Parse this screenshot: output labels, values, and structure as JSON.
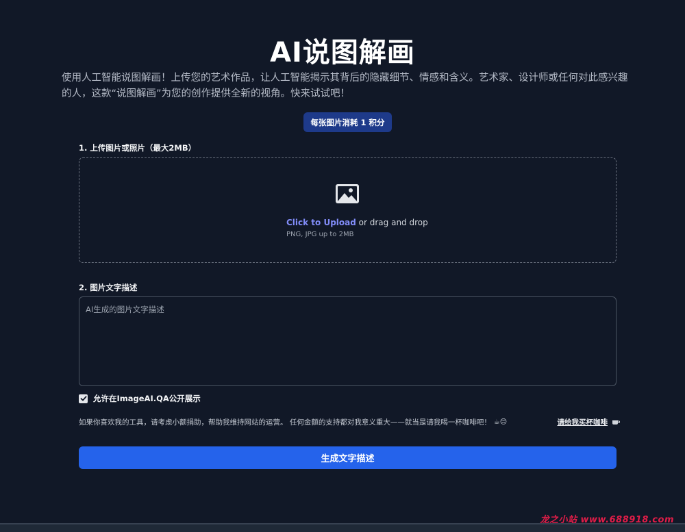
{
  "header": {
    "title": "AI说图解画",
    "intro": "使用人工智能说图解画！上传您的艺术作品，让人工智能揭示其背后的隐藏细节、情感和含义。艺术家、设计师或任何对此感兴趣的人，这款“说图解画”为您的创作提供全新的视角。快来试试吧！"
  },
  "cost_badge": "每张图片消耗 1 积分",
  "upload": {
    "label": "1. 上传图片或照片（最大2MB）",
    "link_text": "Click to Upload",
    "drag_text": " or drag and drop",
    "hint": "PNG, JPG up to 2MB",
    "icon": "image-icon"
  },
  "description": {
    "label": "2. 图片文字描述",
    "placeholder": "AI生成的图片文字描述",
    "value": ""
  },
  "public_option": {
    "label": "允许在ImageAI.QA公开展示",
    "checked": true
  },
  "donate": {
    "text": "如果你喜欢我的工具，请考虑小额捐助，帮助我维持网站的运营。 任何金额的支持都对我意义重大——就当是请我喝一杯咖啡吧！",
    "emoji": "☕😊",
    "link": "请给我买杯咖啡"
  },
  "generate_button": "生成文字描述",
  "watermark": "龙之小站 www.688918.com",
  "colors": {
    "background": "#111827",
    "accent": "#2563eb",
    "badge": "#1e3a8a",
    "link": "#818cf8"
  }
}
